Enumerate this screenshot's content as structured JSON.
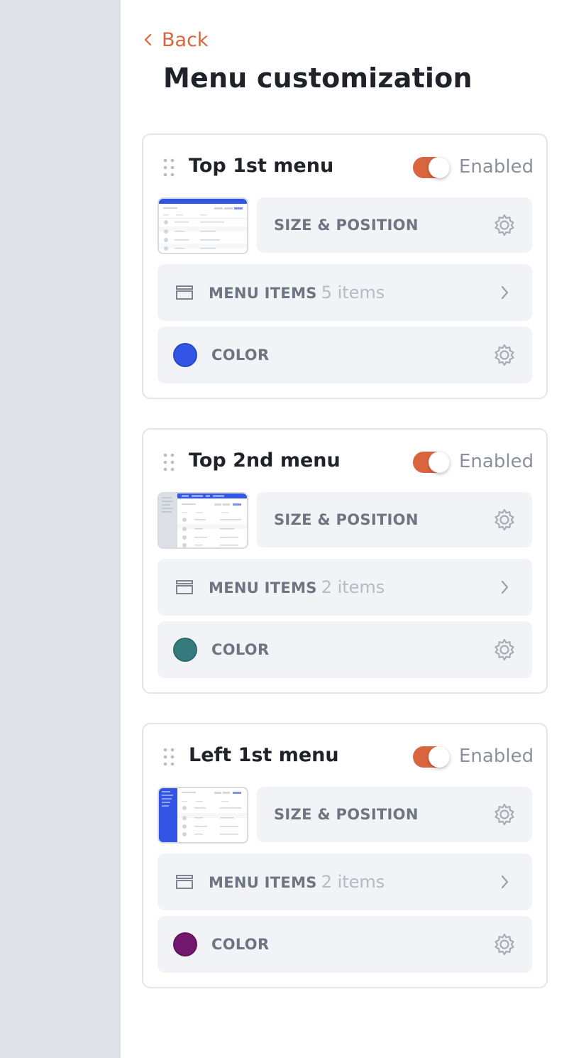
{
  "nav": {
    "back_label": "Back"
  },
  "page": {
    "title": "Menu customization"
  },
  "menus": [
    {
      "title": "Top 1st menu",
      "toggle_label": "Enabled",
      "enabled": true,
      "size_label": "SIZE & POSITION",
      "items_label": "MENU ITEMS",
      "items_count": "5 items",
      "color_label": "COLOR",
      "color": "#3355e6",
      "thumb_style": "top-bar"
    },
    {
      "title": "Top 2nd menu",
      "toggle_label": "Enabled",
      "enabled": true,
      "size_label": "SIZE & POSITION",
      "items_label": "MENU ITEMS",
      "items_count": "2 items",
      "color_label": "COLOR",
      "color": "#357b7d",
      "thumb_style": "top-bar-with-side"
    },
    {
      "title": "Left 1st menu",
      "toggle_label": "Enabled",
      "enabled": true,
      "size_label": "SIZE & POSITION",
      "items_label": "MENU ITEMS",
      "items_count": "2 items",
      "color_label": "COLOR",
      "color": "#73176f",
      "thumb_style": "left-bar"
    }
  ],
  "theme": {
    "accent": "#d9653f",
    "sidebar_strip": "#dfe1e8",
    "row_bg": "#f2f3f6",
    "text_muted": "#6e7582"
  }
}
